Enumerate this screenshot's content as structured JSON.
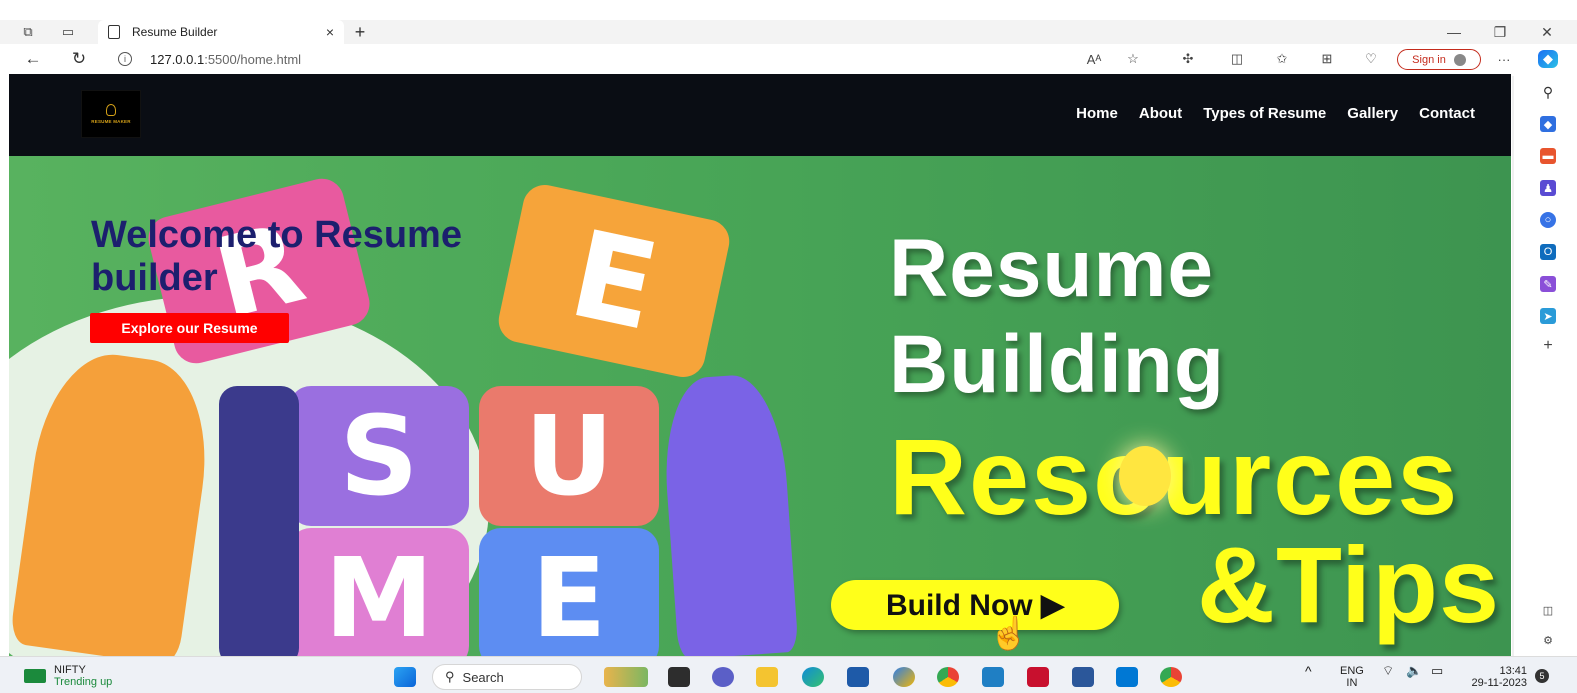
{
  "browser": {
    "tab_title": "Resume Builder",
    "tab_close": "×",
    "new_tab": "+",
    "url_host": "127.0.0.1",
    "url_path": ":5500/home.html",
    "signin_label": "Sign in",
    "more": "···"
  },
  "site": {
    "logo_text": "RESUME MAKER",
    "nav": [
      "Home",
      "About",
      "Types of Resume",
      "Gallery",
      "Contact"
    ],
    "hero_title": "Welcome to Resume builder",
    "hero_button": "Explore our Resume",
    "cube_letters": [
      "R",
      "E",
      "S",
      "U",
      "M",
      "E"
    ],
    "banner_line1": "Resume",
    "banner_line2": "Building",
    "banner_line3": "Resources",
    "banner_line4": "&Tips",
    "banner_button": "Build Now ▶"
  },
  "taskbar": {
    "nifty_label": "NIFTY",
    "nifty_status": "Trending up",
    "search_label": "Search",
    "lang_top": "ENG",
    "lang_bottom": "IN",
    "time": "13:41",
    "date": "29-11-2023",
    "notification_count": "5"
  },
  "colors": {
    "navbar": "#0a0d14",
    "hero_green": "#49a657",
    "hero_title": "#1c1f6e",
    "hero_button": "#ff0000",
    "banner_yellow": "#ffff1a",
    "signin_accent": "#c42b1c"
  }
}
